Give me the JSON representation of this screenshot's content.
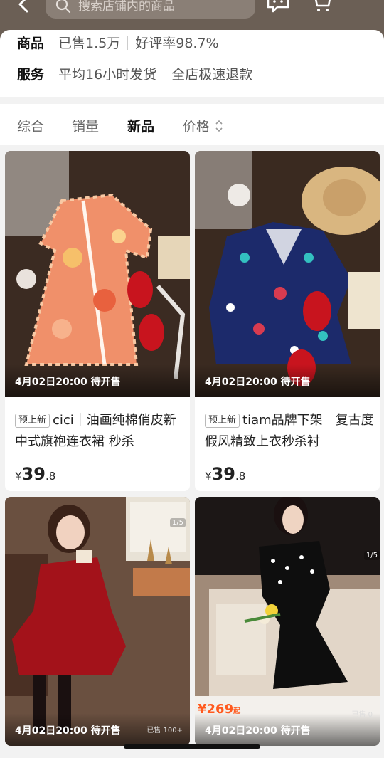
{
  "header": {
    "search_placeholder": "搜索店铺内的商品",
    "icons": [
      "back-icon",
      "search-icon",
      "chat-icon",
      "cart-icon",
      "more-icon"
    ]
  },
  "shop_info": {
    "goods_label": "商品",
    "sold": "已售1.5万",
    "rating": "好评率98.7%",
    "service_label": "服务",
    "shipping": "平均16小时发货",
    "refund": "全店极速退款"
  },
  "sort_tabs": {
    "overall": "综合",
    "sales": "销量",
    "new": "新品",
    "price": "价格",
    "active": "新品"
  },
  "products": [
    {
      "presale": "4月02日20:00 待开售",
      "tag": "预上新",
      "title": "cici｜油画纯棉俏皮新中式旗袍连衣裙 秒杀",
      "currency": "¥",
      "price_int": "39",
      "price_dec": ".8"
    },
    {
      "presale": "4月02日20:00 待开售",
      "tag": "预上新",
      "title": "tiam品牌下架｜复古度假风精致上衣秒杀衬",
      "currency": "¥",
      "price_int": "39",
      "price_dec": ".8"
    },
    {
      "presale": "4月02日20:00 待开售",
      "image_count": "1/5",
      "sold_small": "已售 100+"
    },
    {
      "presale": "4月02日20:00 待开售",
      "image_count": "1/5",
      "price_red": "¥269",
      "price_suffix": "起",
      "sold_small": "已售 0"
    }
  ],
  "colors": {
    "accent_price": "#ff5a1f",
    "top_bar": "#6b5f55"
  }
}
